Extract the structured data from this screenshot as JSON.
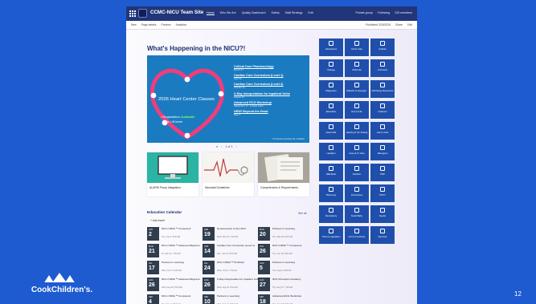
{
  "slide": {
    "logo_text": "CookChildren's.",
    "slide_number": "12"
  },
  "colors": {
    "slide_bg": "#1e5bd1",
    "suitebar": "#21367a",
    "tile": "#1f4fab",
    "hero": "#1b7bc0",
    "heart": "#f13d7c"
  },
  "topbar": {
    "site_title": "CCMC-NICU Team Site",
    "nav": [
      "Home",
      "Who We Are",
      "Quality Dashboard",
      "Safety",
      "Staff Strategy",
      "Edit"
    ],
    "right": [
      "Private group",
      "Following",
      "133 members"
    ]
  },
  "cmdbar": {
    "left": [
      "New",
      "Page details",
      "Preview",
      "Analytics"
    ],
    "right": [
      "Published 3/26/2026",
      "Share",
      "Edit"
    ]
  },
  "main": {
    "section_title": "What's Happening in the NICU?!",
    "hero": {
      "title": "2026 Heart Center Classes",
      "bullet_prefix": "• Registration",
      "bullet_highlight": "Available",
      "bullet_sub": "in LB.learn",
      "events": [
        {
          "title": "Critical Care Pharmacology",
          "date": "March 27"
        },
        {
          "title": "Cardiac Core Curriculum (Level 1)",
          "date": "April 13"
        },
        {
          "title": "Cardiac Core Curriculum (Level 2)",
          "date": "October 11"
        },
        {
          "title": "X-Ray Interpretation for Inpatient Units",
          "date": "August 14"
        },
        {
          "title": "Advanced ECG Workshop",
          "date": "September 17 · Limited seats"
        },
        {
          "title": "NEW! Beyond the Heart",
          "date": "New 7"
        }
      ],
      "footer": "* All classes providing CE, available"
    },
    "pager": {
      "prev": "‹",
      "text": "1 of 3",
      "next": "›"
    },
    "cards": [
      {
        "label": "ALARIS Pump Integration"
      },
      {
        "label": "Neonatal Guidelines"
      },
      {
        "label": "Competencies & Requirements"
      }
    ]
  },
  "calendar": {
    "title": "Education Calendar",
    "add": "+ Add event",
    "see_all": "See all",
    "events": [
      {
        "mon": "JAN",
        "day": "2",
        "name": "NICU ORIGI™ Competent",
        "when": "Thu, Jan 2, 8:00 AM"
      },
      {
        "mon": "FEB",
        "day": "19",
        "name": "Neoprotective to the NICU",
        "when": "Wed, Feb 19, 1:00 PM"
      },
      {
        "mon": "MAR",
        "day": "20",
        "name": "Partners in Learning",
        "when": "Thu, Mar 20, 8:00 AM"
      },
      {
        "mon": "MAR",
        "day": "21",
        "name": "NICU ORIGI™ Advanced Beginner",
        "when": "Fri, Mar 21, 7:30 AM"
      },
      {
        "mon": "APR",
        "day": "14",
        "name": "Cardiac Core Curriculum (Level 1)",
        "when": "Mon, Apr 14, 8:00 AM"
      },
      {
        "mon": "JUN",
        "day": "26",
        "name": "NICU ORIGI™ Competent",
        "when": "Thu, Jun 26, 8:00 AM"
      },
      {
        "mon": "JUL",
        "day": "17",
        "name": "Partners in Learning",
        "when": "Wed, Jul 17, 8:00 AM"
      },
      {
        "mon": "JUL",
        "day": "24",
        "name": "NICU ORIGI™ Proficient",
        "when": "Wed, Jul 24, 7:30 AM"
      },
      {
        "mon": "AUG",
        "day": "5",
        "name": "Partners in Learning",
        "when": "Tue, Aug 5, 8:00 AM"
      },
      {
        "mon": "AUG",
        "day": "26",
        "name": "NICU ORIGI™ Advanced Beginner",
        "when": "Wed, Aug 26, 8:00 AM"
      },
      {
        "mon": "AUG",
        "day": "26",
        "name": "X-Ray Interpretation for Inpatient Units",
        "when": "Wed, Aug 26, 8:00 AM"
      },
      {
        "mon": "AUG",
        "day": "27",
        "name": "NICU Preceptor Academy",
        "when": "Thu, Aug 27, 7:30 AM"
      },
      {
        "mon": "SEP",
        "day": "4",
        "name": "NICU ORIGI™ Competent",
        "when": "Thu, Sep 4, 8:00 AM"
      },
      {
        "mon": "SEP",
        "day": "10",
        "name": "Partners in Learning",
        "when": "Wed, Sep 10, 8:00 AM"
      },
      {
        "mon": "SEP",
        "day": "18",
        "name": "Advanced ECG Workshop",
        "when": "Thu, Sep 18, 8:00 AM"
      }
    ]
  },
  "quick_links": [
    {
      "label": "Admissions",
      "icon": "clipboard-icon"
    },
    {
      "label": "Acute Care",
      "icon": "plus-icon"
    },
    {
      "label": "Cardiac",
      "icon": "heart-icon"
    },
    {
      "label": "Change",
      "icon": "refresh-icon"
    },
    {
      "label": "Child Life",
      "icon": "child-icon"
    },
    {
      "label": "Contracts",
      "icon": "document-icon"
    },
    {
      "label": "Diagnoses",
      "icon": "stethoscope-icon"
    },
    {
      "label": "Diabetic & Hypoglyc.",
      "icon": "drop-icon"
    },
    {
      "label": "Discharge Resources",
      "icon": "door-icon"
    },
    {
      "label": "Education",
      "icon": "book-icon"
    },
    {
      "label": "End of Life",
      "icon": "dove-icon"
    },
    {
      "label": "Instacom",
      "icon": "chat-icon"
    },
    {
      "label": "Hand-Offs",
      "icon": "handshake-icon"
    },
    {
      "label": "Hearing & CF Testing",
      "icon": "ear-icon"
    },
    {
      "label": "Lab & Units",
      "icon": "flask-icon"
    },
    {
      "label": "Lactation",
      "icon": "bottle-icon"
    },
    {
      "label": "Lines & IV Care",
      "icon": "line-icon"
    },
    {
      "label": "Managers",
      "icon": "people-icon"
    },
    {
      "label": "Milk Bank",
      "icon": "milk-icon"
    },
    {
      "label": "Nutrition",
      "icon": "apple-icon"
    },
    {
      "label": "PDP",
      "icon": "target-icon"
    },
    {
      "label": "Pharmacy",
      "icon": "pill-icon"
    },
    {
      "label": "Procedures",
      "icon": "scalpel-icon"
    },
    {
      "label": "POCT",
      "icon": "monitor-icon"
    },
    {
      "label": "Respiratory",
      "icon": "lungs-icon"
    },
    {
      "label": "Small Baby",
      "icon": "baby-icon"
    },
    {
      "label": "Sepsis",
      "icon": "alert-icon"
    },
    {
      "label": "Thermo-regulation",
      "icon": "thermometer-icon"
    },
    {
      "label": "Unit Committees",
      "icon": "group-icon"
    },
    {
      "label": "Vaccines",
      "icon": "syringe-icon"
    }
  ]
}
